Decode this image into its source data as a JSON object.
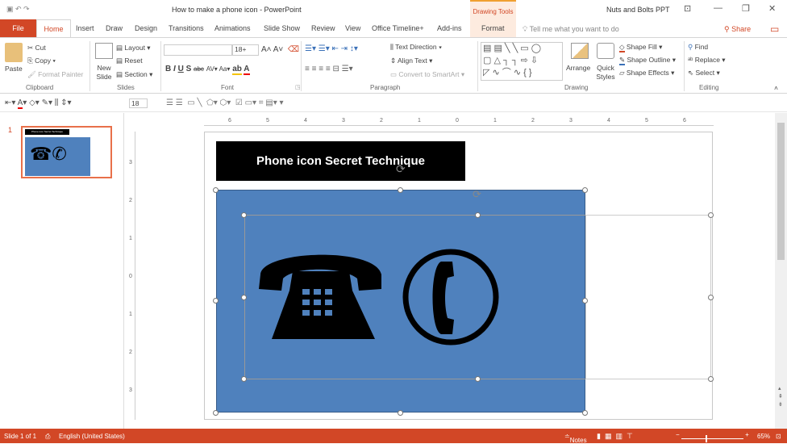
{
  "window": {
    "title": "How to make a phone icon  -  PowerPoint",
    "context_tab_group": "Drawing Tools",
    "user": "Nuts and Bolts PPT"
  },
  "tabs": [
    "File",
    "Home",
    "Insert",
    "Draw",
    "Design",
    "Transitions",
    "Animations",
    "Slide Show",
    "Review",
    "View",
    "Office Timeline+",
    "Add-ins",
    "Format"
  ],
  "tell_me": "Tell me what you want to do",
  "share": "Share",
  "ribbon": {
    "clipboard": {
      "label": "Clipboard",
      "paste": "Paste",
      "cut": "Cut",
      "copy": "Copy",
      "format_painter": "Format Painter"
    },
    "slides": {
      "label": "Slides",
      "new_slide": "New Slide",
      "layout": "Layout",
      "reset": "Reset",
      "section": "Section"
    },
    "font": {
      "label": "Font",
      "font_name": "",
      "font_size": "18+"
    },
    "paragraph": {
      "label": "Paragraph",
      "text_direction": "Text Direction",
      "align_text": "Align Text",
      "convert": "Convert to SmartArt"
    },
    "drawing": {
      "label": "Drawing",
      "arrange": "Arrange",
      "quick_styles": "Quick Styles",
      "shape_fill": "Shape Fill",
      "shape_outline": "Shape Outline",
      "shape_effects": "Shape Effects"
    },
    "editing": {
      "label": "Editing",
      "find": "Find",
      "replace": "Replace",
      "select": "Select"
    }
  },
  "qat": {
    "font_size": "18"
  },
  "thumbnails": [
    {
      "number": "1",
      "title": "Phone icon Secret Technique"
    }
  ],
  "ruler": {
    "h": [
      "6",
      "5",
      "4",
      "3",
      "2",
      "1",
      "0",
      "1",
      "2",
      "3",
      "4",
      "5",
      "6"
    ],
    "v": [
      "3",
      "2",
      "1",
      "0",
      "1",
      "2",
      "3"
    ]
  },
  "slide": {
    "title": "Phone icon Secret Technique",
    "fill": "#4f81bd"
  },
  "status": {
    "slide": "Slide 1 of 1",
    "language": "English (United States)",
    "notes": "Notes",
    "zoom": "65%",
    "accent": "#d24726"
  }
}
